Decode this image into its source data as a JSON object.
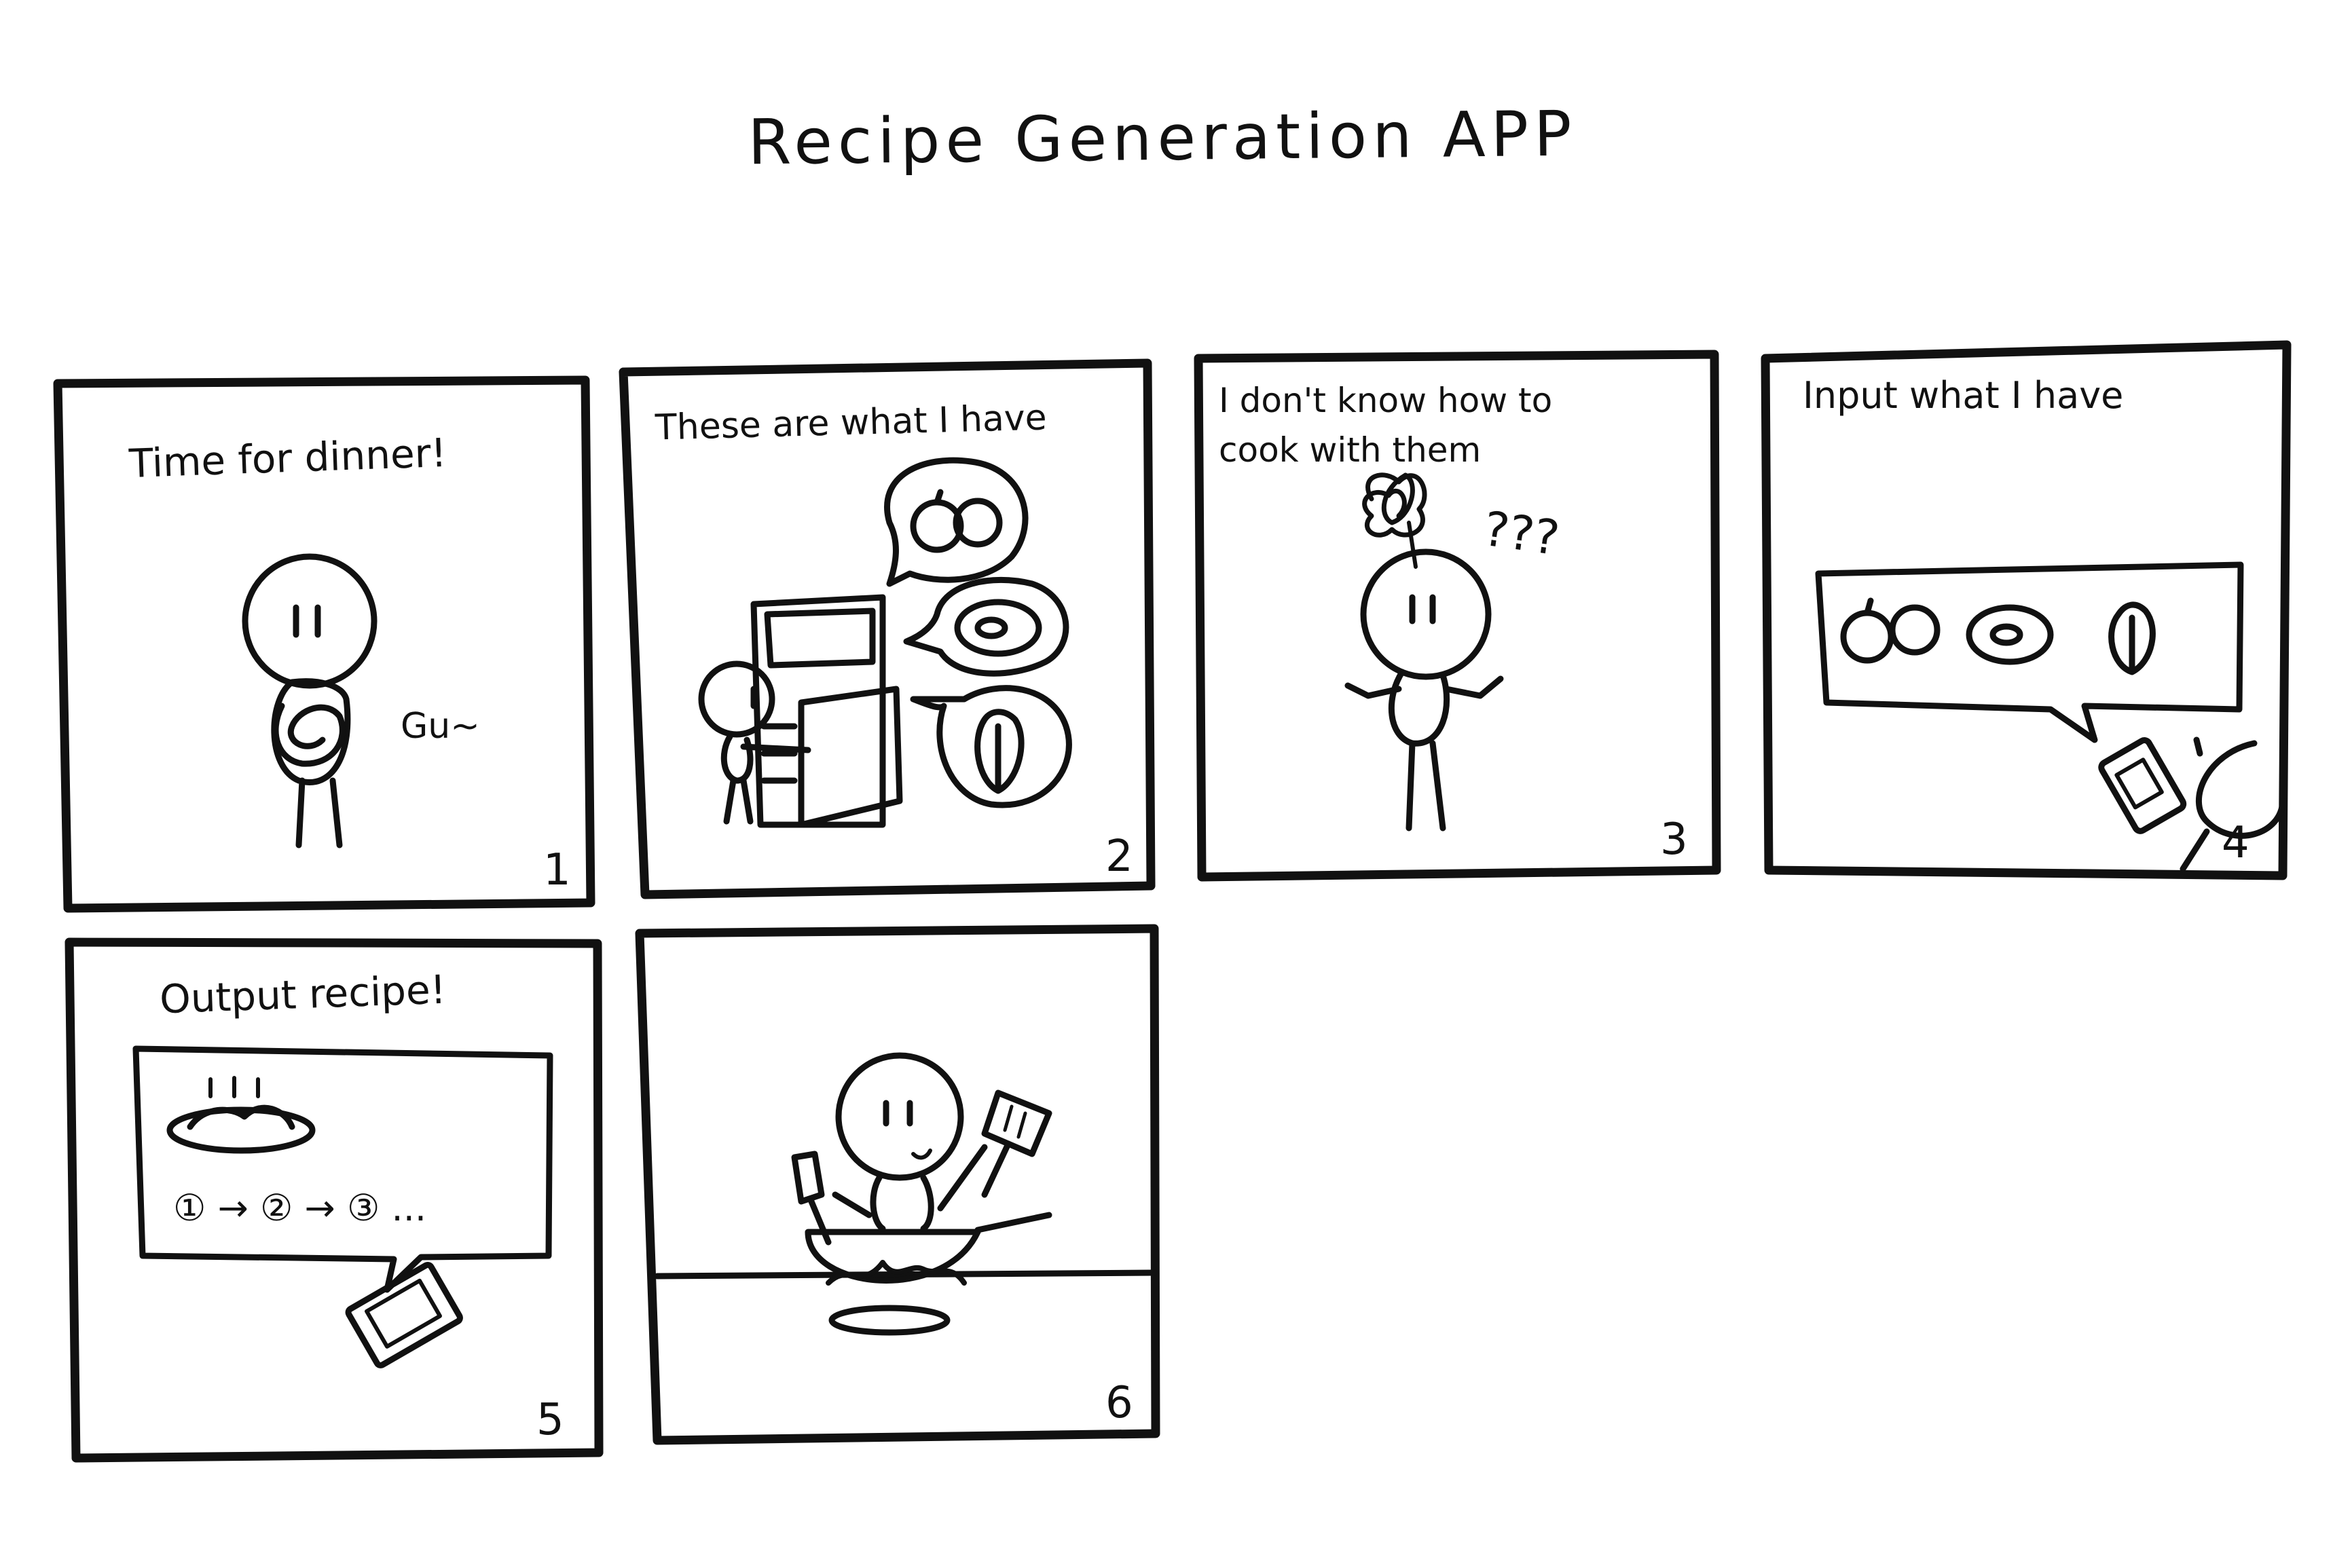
{
  "title": "Recipe Generation APP",
  "panels": [
    {
      "caption": "Time for dinner!",
      "number": "1",
      "sfx": "Gu~"
    },
    {
      "caption": "These are what I have",
      "number": "2"
    },
    {
      "caption_line1": "I don't know how to",
      "caption_line2": "cook with them",
      "number": "3",
      "sfx": "???"
    },
    {
      "caption": "Input what I have",
      "number": "4"
    },
    {
      "caption": "Output recipe!",
      "number": "5",
      "steps": "① → ② → ③ ..."
    },
    {
      "number": "6"
    }
  ],
  "colors": {
    "ink": "#111111",
    "paper": "#ffffff",
    "shade": "#e9e9e9"
  }
}
